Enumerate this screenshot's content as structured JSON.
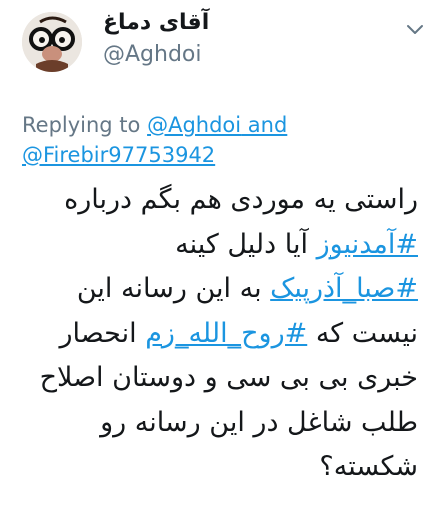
{
  "author": {
    "display_name": "آقای دماغ",
    "handle": "@Aghdoi"
  },
  "reply": {
    "prefix": "Replying to ",
    "mention_1": "@Aghdoi",
    "conjunction": " and",
    "mention_2": "@Firebir97753942"
  },
  "tweet": {
    "line1": "راستی یه موردی هم بگم درباره",
    "line2_hashtag": "#آمدنیوز",
    "line2_text": " آیا دلیل کینه",
    "line3_hashtag": "#صبا_آذرپیک",
    "line3_text": " به این رسانه این",
    "line4_text_start": "نیست که ",
    "line4_hashtag": "#روح_الله_زم",
    "line4_text_end": " انحصار",
    "line5": "خبری بی بی سی و دوستان اصلاح",
    "line6": "طلب شاغل در این رسانه رو",
    "line7": "شکسته؟"
  },
  "icons": {
    "avatar": "avatar-glasses-nose",
    "menu": "chevron-down-icon"
  },
  "colors": {
    "link": "#1b95e0",
    "secondary_text": "#657786",
    "primary_text": "#14171a"
  }
}
